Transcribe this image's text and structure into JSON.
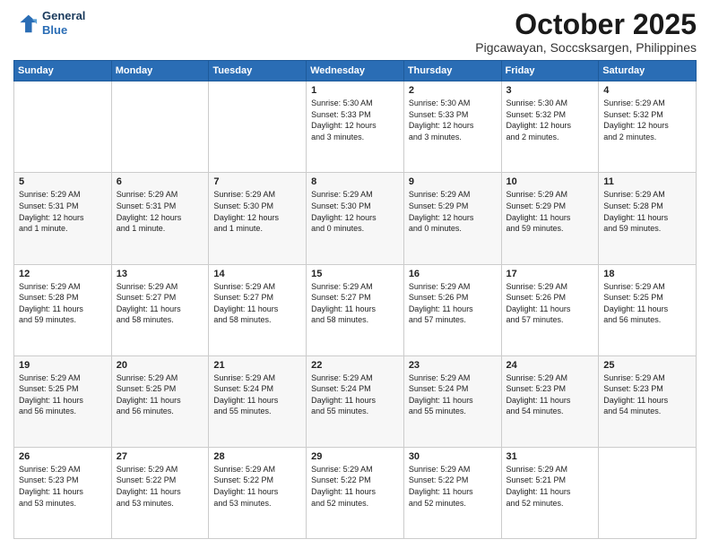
{
  "header": {
    "logo_line1": "General",
    "logo_line2": "Blue",
    "month": "October 2025",
    "location": "Pigcawayan, Soccsksargen, Philippines"
  },
  "weekdays": [
    "Sunday",
    "Monday",
    "Tuesday",
    "Wednesday",
    "Thursday",
    "Friday",
    "Saturday"
  ],
  "weeks": [
    [
      {
        "day": "",
        "text": ""
      },
      {
        "day": "",
        "text": ""
      },
      {
        "day": "",
        "text": ""
      },
      {
        "day": "1",
        "text": "Sunrise: 5:30 AM\nSunset: 5:33 PM\nDaylight: 12 hours\nand 3 minutes."
      },
      {
        "day": "2",
        "text": "Sunrise: 5:30 AM\nSunset: 5:33 PM\nDaylight: 12 hours\nand 3 minutes."
      },
      {
        "day": "3",
        "text": "Sunrise: 5:30 AM\nSunset: 5:32 PM\nDaylight: 12 hours\nand 2 minutes."
      },
      {
        "day": "4",
        "text": "Sunrise: 5:29 AM\nSunset: 5:32 PM\nDaylight: 12 hours\nand 2 minutes."
      }
    ],
    [
      {
        "day": "5",
        "text": "Sunrise: 5:29 AM\nSunset: 5:31 PM\nDaylight: 12 hours\nand 1 minute."
      },
      {
        "day": "6",
        "text": "Sunrise: 5:29 AM\nSunset: 5:31 PM\nDaylight: 12 hours\nand 1 minute."
      },
      {
        "day": "7",
        "text": "Sunrise: 5:29 AM\nSunset: 5:30 PM\nDaylight: 12 hours\nand 1 minute."
      },
      {
        "day": "8",
        "text": "Sunrise: 5:29 AM\nSunset: 5:30 PM\nDaylight: 12 hours\nand 0 minutes."
      },
      {
        "day": "9",
        "text": "Sunrise: 5:29 AM\nSunset: 5:29 PM\nDaylight: 12 hours\nand 0 minutes."
      },
      {
        "day": "10",
        "text": "Sunrise: 5:29 AM\nSunset: 5:29 PM\nDaylight: 11 hours\nand 59 minutes."
      },
      {
        "day": "11",
        "text": "Sunrise: 5:29 AM\nSunset: 5:28 PM\nDaylight: 11 hours\nand 59 minutes."
      }
    ],
    [
      {
        "day": "12",
        "text": "Sunrise: 5:29 AM\nSunset: 5:28 PM\nDaylight: 11 hours\nand 59 minutes."
      },
      {
        "day": "13",
        "text": "Sunrise: 5:29 AM\nSunset: 5:27 PM\nDaylight: 11 hours\nand 58 minutes."
      },
      {
        "day": "14",
        "text": "Sunrise: 5:29 AM\nSunset: 5:27 PM\nDaylight: 11 hours\nand 58 minutes."
      },
      {
        "day": "15",
        "text": "Sunrise: 5:29 AM\nSunset: 5:27 PM\nDaylight: 11 hours\nand 58 minutes."
      },
      {
        "day": "16",
        "text": "Sunrise: 5:29 AM\nSunset: 5:26 PM\nDaylight: 11 hours\nand 57 minutes."
      },
      {
        "day": "17",
        "text": "Sunrise: 5:29 AM\nSunset: 5:26 PM\nDaylight: 11 hours\nand 57 minutes."
      },
      {
        "day": "18",
        "text": "Sunrise: 5:29 AM\nSunset: 5:25 PM\nDaylight: 11 hours\nand 56 minutes."
      }
    ],
    [
      {
        "day": "19",
        "text": "Sunrise: 5:29 AM\nSunset: 5:25 PM\nDaylight: 11 hours\nand 56 minutes."
      },
      {
        "day": "20",
        "text": "Sunrise: 5:29 AM\nSunset: 5:25 PM\nDaylight: 11 hours\nand 56 minutes."
      },
      {
        "day": "21",
        "text": "Sunrise: 5:29 AM\nSunset: 5:24 PM\nDaylight: 11 hours\nand 55 minutes."
      },
      {
        "day": "22",
        "text": "Sunrise: 5:29 AM\nSunset: 5:24 PM\nDaylight: 11 hours\nand 55 minutes."
      },
      {
        "day": "23",
        "text": "Sunrise: 5:29 AM\nSunset: 5:24 PM\nDaylight: 11 hours\nand 55 minutes."
      },
      {
        "day": "24",
        "text": "Sunrise: 5:29 AM\nSunset: 5:23 PM\nDaylight: 11 hours\nand 54 minutes."
      },
      {
        "day": "25",
        "text": "Sunrise: 5:29 AM\nSunset: 5:23 PM\nDaylight: 11 hours\nand 54 minutes."
      }
    ],
    [
      {
        "day": "26",
        "text": "Sunrise: 5:29 AM\nSunset: 5:23 PM\nDaylight: 11 hours\nand 53 minutes."
      },
      {
        "day": "27",
        "text": "Sunrise: 5:29 AM\nSunset: 5:22 PM\nDaylight: 11 hours\nand 53 minutes."
      },
      {
        "day": "28",
        "text": "Sunrise: 5:29 AM\nSunset: 5:22 PM\nDaylight: 11 hours\nand 53 minutes."
      },
      {
        "day": "29",
        "text": "Sunrise: 5:29 AM\nSunset: 5:22 PM\nDaylight: 11 hours\nand 52 minutes."
      },
      {
        "day": "30",
        "text": "Sunrise: 5:29 AM\nSunset: 5:22 PM\nDaylight: 11 hours\nand 52 minutes."
      },
      {
        "day": "31",
        "text": "Sunrise: 5:29 AM\nSunset: 5:21 PM\nDaylight: 11 hours\nand 52 minutes."
      },
      {
        "day": "",
        "text": ""
      }
    ]
  ]
}
